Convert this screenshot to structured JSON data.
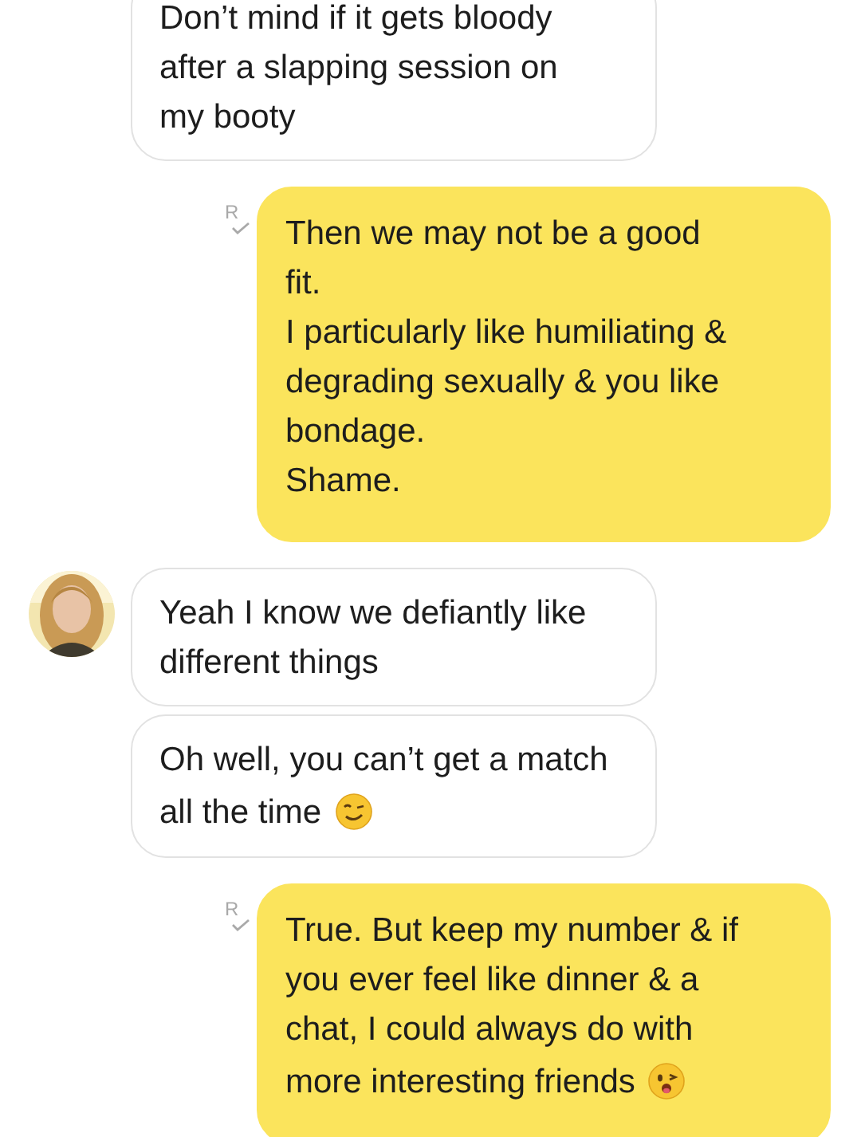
{
  "messages": [
    {
      "kind": "incoming",
      "text": "Don’t mind if it gets bloody\nafter a slapping session on\nmy booty"
    },
    {
      "kind": "outgoing",
      "receipt": "R",
      "text": "Then we may not be a good\nfit.\nI particularly like humiliating &\ndegrading sexually & you like\nbondage.\nShame."
    },
    {
      "kind": "incoming",
      "text": "Yeah I know we defiantly like\ndifferent things"
    },
    {
      "kind": "incoming",
      "text": "Oh well, you can’t get a match\nall the time",
      "trailing_icon": {
        "kind": "smirk"
      }
    },
    {
      "kind": "outgoing",
      "receipt": "R",
      "text": "True. But keep my number & if\nyou ever feel like dinner & a\nchat, I could always do with\nmore interesting friends",
      "trailing_icon": {
        "kind": "wink-tongue"
      }
    }
  ]
}
